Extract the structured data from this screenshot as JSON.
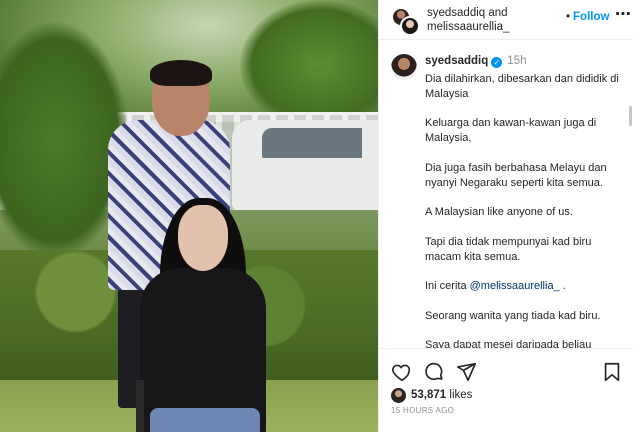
{
  "post": {
    "image_alt": "",
    "header": {
      "owners_line1": "syedsaddiq and",
      "owners_line2": "melissaaurellia_",
      "follow_separator": "•",
      "follow_label": "Follow",
      "more_icon": "more-horizontal-icon"
    },
    "caption": {
      "username": "syedsaddiq",
      "verified_icon": "verified-badge-icon",
      "time": "15h",
      "paragraphs": [
        "Dia dilahirkan, dibesarkan dan dididik di Malaysia",
        "Keluarga dan kawan-kawan juga di Malaysia,",
        "Dia juga fasih berbahasa Melayu dan nyanyi Negaraku seperti kita semua.",
        "A Malaysian like anyone of us.",
        "Tapi dia tidak mempunyai kad biru macam kita semua.",
        "Seorang wanita yang tiada kad biru.",
        "Saya dapat mesej daripada beliau"
      ],
      "mention_prefix": "Ini cerita ",
      "mention": "@melissaaurellia_",
      "mention_suffix": " ."
    },
    "actions": {
      "like_icon": "heart-icon",
      "comment_icon": "comment-icon",
      "share_icon": "paper-plane-icon",
      "save_icon": "bookmark-icon"
    },
    "likes": {
      "count": "53,871",
      "label": " likes"
    },
    "timestamp": "15 HOURS AGO",
    "colors": {
      "link": "#0095f6",
      "mention": "#00376b",
      "muted": "#8e8e8e",
      "text": "#262626"
    }
  }
}
